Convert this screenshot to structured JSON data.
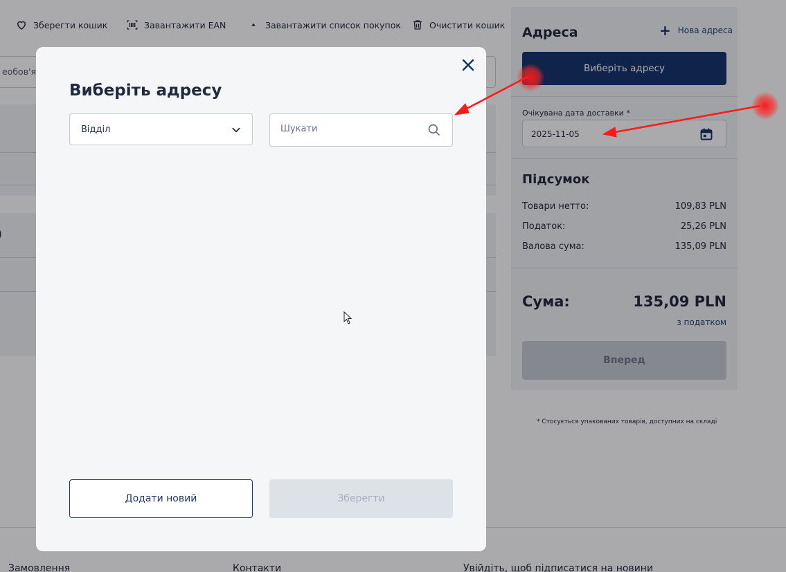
{
  "toolbar": {
    "save_cart": "Зберегти кошик",
    "upload_ean": "Завантажити EAN",
    "upload_list": "Завантажити список покупок",
    "clear_cart": "Очистити кошик",
    "icons": [
      "heart-icon",
      "barcode-icon",
      "upload-icon",
      "trash-icon"
    ]
  },
  "background": {
    "field_placeholder": "еобов'яз",
    "paren": ")"
  },
  "sidebar": {
    "title": "Адреса",
    "new_address": "Нова адреса",
    "choose_address_button": "Виберіть адресу",
    "date_label": "Очікувана дата доставки *",
    "date_value": "2025-11-05",
    "summary_title": "Підсумок",
    "rows": [
      {
        "label": "Товари нетто:",
        "value": "109,83 PLN"
      },
      {
        "label": "Податок:",
        "value": "25,26 PLN"
      },
      {
        "label": "Валова сума:",
        "value": "135,09 PLN"
      }
    ],
    "total_label": "Сума:",
    "total_value": "135,09 PLN",
    "tax_note": "з податком",
    "next_button": "Вперед",
    "stock_note": "* Стосується упакованих товарів, доступних на складі"
  },
  "footer": {
    "orders": "Замовлення",
    "contacts": "Контакти",
    "newsletter": "Увійдіть, щоб підписатися на новини"
  },
  "modal": {
    "title": "Виберіть адресу",
    "select_value": "Відділ",
    "search_placeholder": "Шукати",
    "add_new_button": "Додати новий",
    "save_button": "Зберегти"
  },
  "colors": {
    "primary": "#0f2d66",
    "link": "#1c3a6e",
    "annotation": "#ff1a1a",
    "overlay": "rgba(20,20,24,0.36)"
  }
}
